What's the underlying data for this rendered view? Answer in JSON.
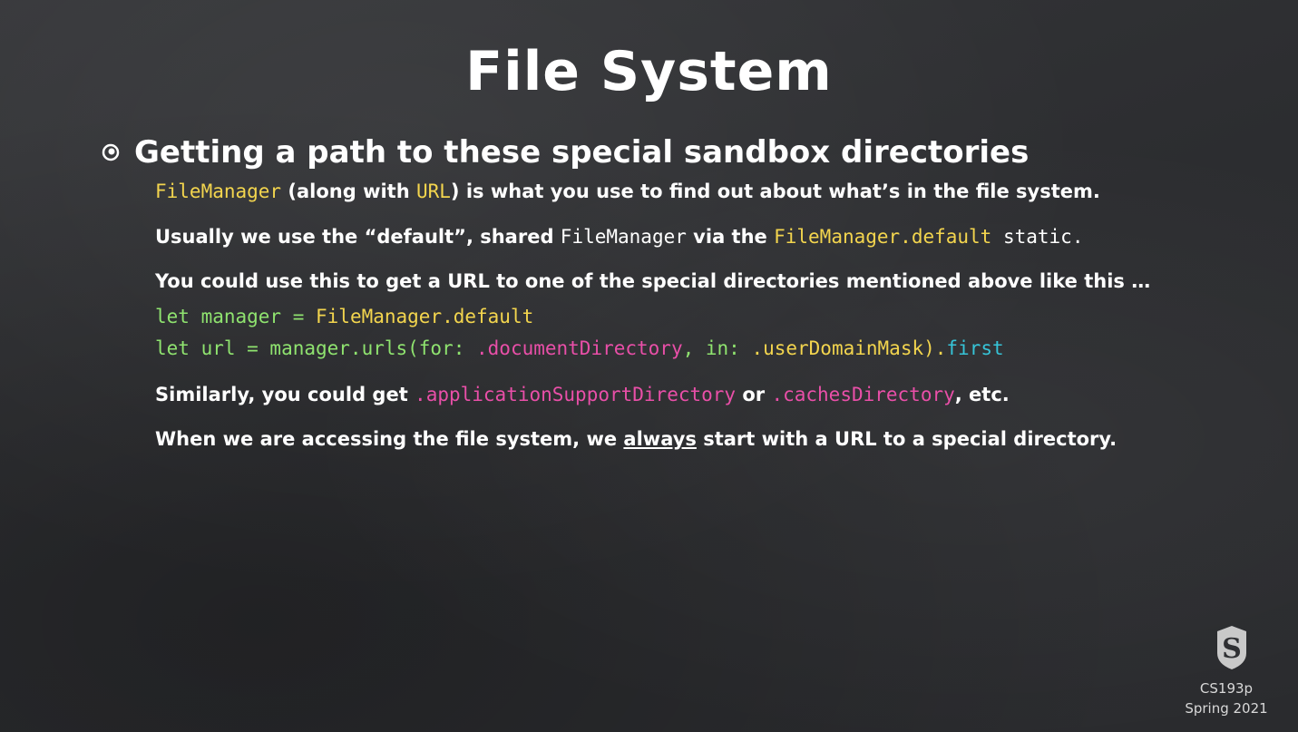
{
  "slide": {
    "title": "File System",
    "bullet": "Getting a path to these special sandbox directories",
    "line1": {
      "code1": "FileManager",
      "t1": " (along with ",
      "code2": "URL",
      "t2": ") is what you use to find out about what’s in the file system."
    },
    "line2": {
      "t1": "Usually we use the “default”, shared ",
      "code1": "FileManager",
      "t2": " via the ",
      "code2": "FileManager.default",
      "t3": " static."
    },
    "line3": "You could use this to get a URL to one of the special directories mentioned above like this …",
    "code_a": {
      "kw": "let manager = ",
      "val": "FileManager.default"
    },
    "code_b": {
      "kw": "let url = manager.urls(for: ",
      "arg1": ".documentDirectory",
      "mid": ", in: ",
      "arg2": ".userDomainMask",
      "close": ").",
      "prop": "first"
    },
    "line4": {
      "t1": "Similarly, you could get ",
      "code1": ".applicationSupportDirectory",
      "t2": " or ",
      "code2": ".cachesDirectory",
      "t3": ", etc."
    },
    "line5": {
      "t1": "When we are accessing the file system, we ",
      "emph": "always",
      "t2": " start with a URL to a special directory."
    }
  },
  "footer": {
    "logo_letter": "S",
    "course": "CS193p",
    "term": "Spring 2021"
  },
  "colors": {
    "yellow": "#f3d54e",
    "pink": "#e94fa8",
    "green": "#8fe36f",
    "cyan": "#36c4d8"
  }
}
